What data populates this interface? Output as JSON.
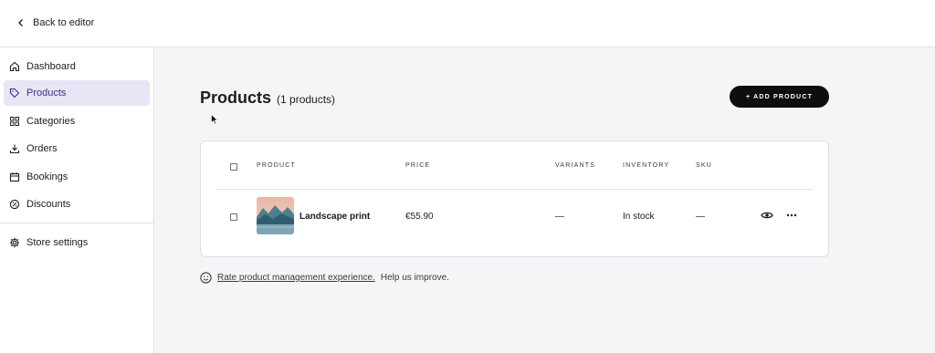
{
  "topbar": {
    "back_label": "Back to editor"
  },
  "sidebar": {
    "items": [
      {
        "label": "Dashboard",
        "icon": "home-icon"
      },
      {
        "label": "Products",
        "icon": "tag-icon",
        "active": true
      },
      {
        "label": "Categories",
        "icon": "grid-icon"
      },
      {
        "label": "Orders",
        "icon": "download-icon"
      },
      {
        "label": "Bookings",
        "icon": "calendar-icon"
      },
      {
        "label": "Discounts",
        "icon": "percent-badge-icon"
      }
    ],
    "settings": {
      "label": "Store settings",
      "icon": "gear-icon"
    },
    "accent": "#3b2f8f",
    "active_bg": "#e9e5f5"
  },
  "main": {
    "title": "Products",
    "count": "(1 products)",
    "add_button": "+ ADD PRODUCT"
  },
  "table": {
    "headers": {
      "product": "PRODUCT",
      "price": "PRICE",
      "variants": "VARIANTS",
      "inventory": "INVENTORY",
      "sku": "SKU"
    },
    "rows": [
      {
        "name": "Landscape print",
        "price": "€55.90",
        "variants": "—",
        "inventory": "In stock",
        "sku": "—"
      }
    ]
  },
  "feedback": {
    "link": "Rate product management experience.",
    "text": "Help us improve."
  }
}
